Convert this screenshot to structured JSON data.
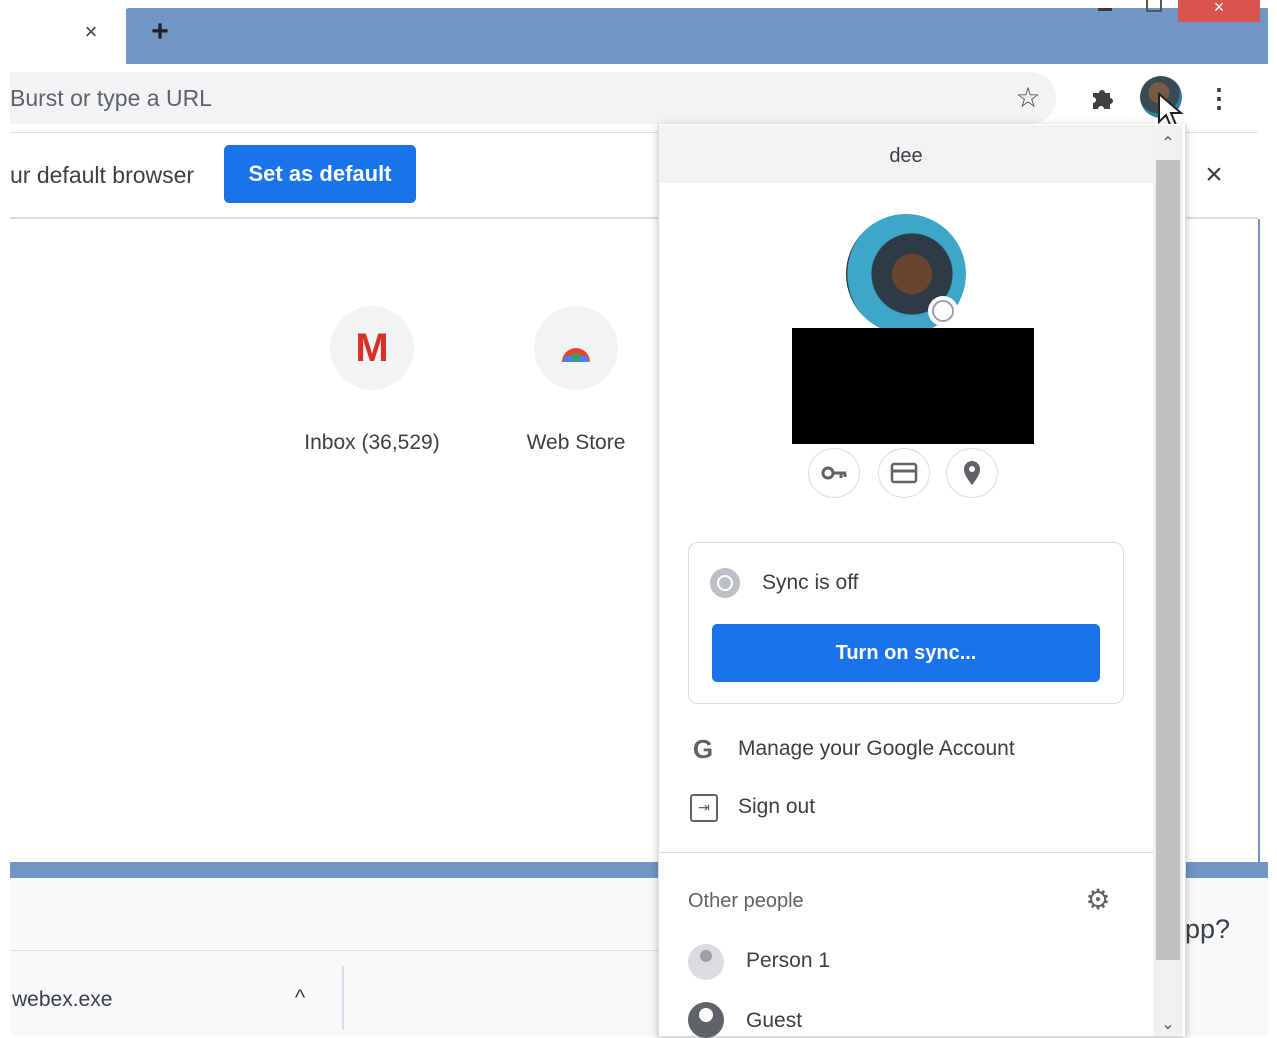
{
  "tabstrip": {
    "tab_close_glyph": "×",
    "new_tab_glyph": "+",
    "window_close_glyph": "×"
  },
  "toolbar": {
    "omnibox_placeholder": "Burst or type a URL",
    "star_icon": "star-icon",
    "extensions_icon": "puzzle-icon",
    "menu_icon": "⋮"
  },
  "infobar": {
    "message": "ur default browser",
    "set_default_label": "Set as default",
    "close_glyph": "×"
  },
  "shortcuts": [
    {
      "label": "Inbox (36,529)",
      "icon": "gmail-icon"
    },
    {
      "label": "Web Store",
      "icon": "web-store-icon"
    }
  ],
  "profile_panel": {
    "name": "dee",
    "sync_status": "Sync is off",
    "turn_on_sync_label": "Turn on sync...",
    "manage_account_label": "Manage your Google Account",
    "sign_out_label": "Sign out",
    "other_people_label": "Other people",
    "people": [
      "Person 1",
      "Guest"
    ]
  },
  "lower_window": {
    "app_prompt_text": "app?",
    "download_filename": "webex.exe",
    "download_chevron": "^"
  },
  "colors": {
    "accent_blue": "#1a73e8",
    "frame_blue": "#6f96c4",
    "window_close_red": "#d9534f"
  }
}
